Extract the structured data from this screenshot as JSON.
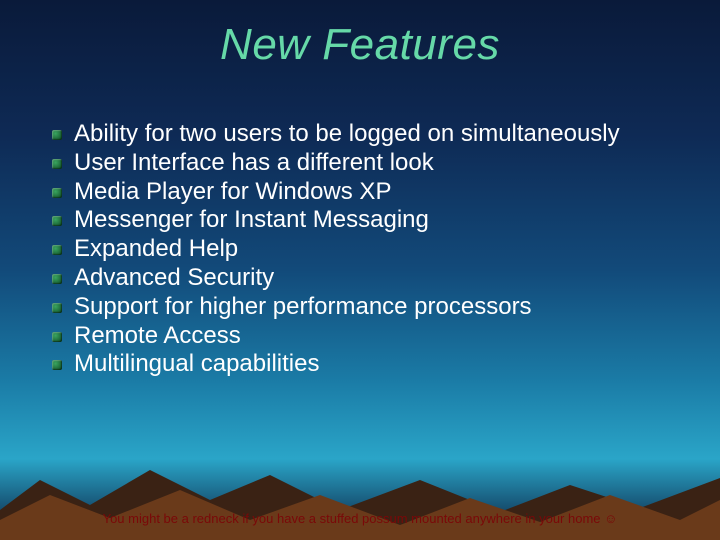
{
  "title": "New Features",
  "bullets": [
    "Ability for two users to be logged on simultaneously",
    "User Interface has a different look",
    "Media Player for Windows XP",
    "Messenger for Instant Messaging",
    "Expanded Help",
    "Advanced Security",
    "Support for higher performance processors",
    "Remote Access",
    "Multilingual capabilities"
  ],
  "footer": {
    "text": "You might be a redneck if you have a stuffed possum mounted anywhere in your home ",
    "smile": "☺"
  },
  "colors": {
    "title": "#66d9a8",
    "text": "#ffffff",
    "footer": "#7a0808"
  }
}
